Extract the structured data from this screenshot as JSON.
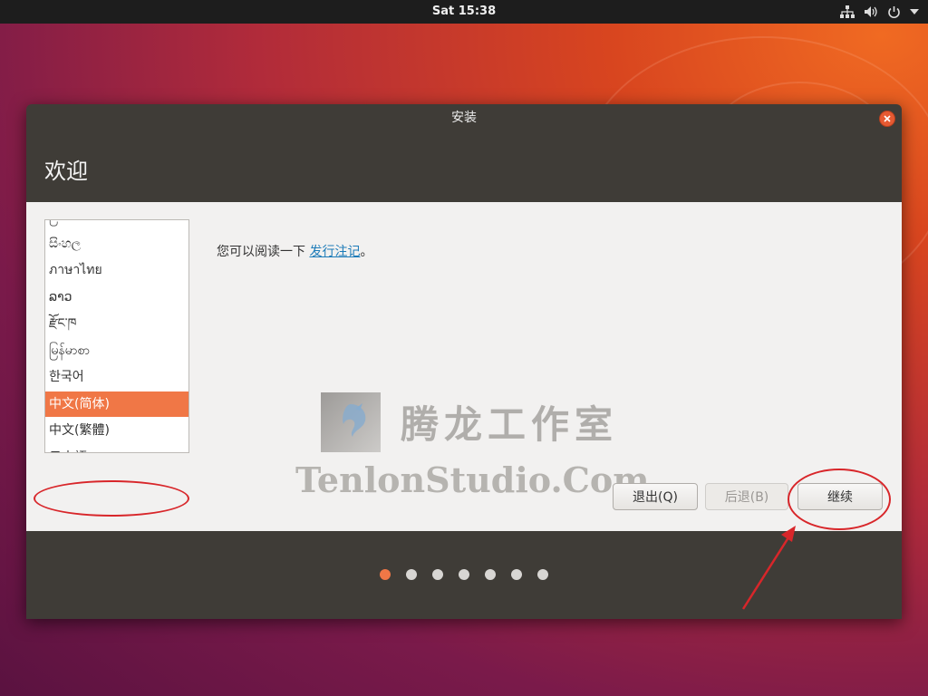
{
  "topbar": {
    "clock": "Sat 15:38"
  },
  "window": {
    "title": "安装",
    "header": "欢迎"
  },
  "languages": [
    {
      "label": "ြ",
      "selected": false
    },
    {
      "label": "සිංහල",
      "selected": false
    },
    {
      "label": "ภาษาไทย",
      "selected": false
    },
    {
      "label": "ລາວ",
      "selected": false
    },
    {
      "label": "རྫོང་ཁ",
      "selected": false
    },
    {
      "label": "မြန်မာစာ",
      "selected": false
    },
    {
      "label": "한국어",
      "selected": false
    },
    {
      "label": "中文(简体)",
      "selected": true
    },
    {
      "label": "中文(繁體)",
      "selected": false
    },
    {
      "label": "日本語",
      "selected": false
    }
  ],
  "note": {
    "prefix": "您可以阅读一下 ",
    "link": "发行注记",
    "suffix": "。"
  },
  "watermark": {
    "cn": "腾龙工作室",
    "en": "TenlonStudio.Com"
  },
  "buttons": {
    "quit": "退出(Q)",
    "back": "后退(B)",
    "next": "继续"
  },
  "progress": {
    "total": 7,
    "current": 1
  },
  "colors": {
    "accent": "#f07746",
    "annotation": "#d8262a",
    "header_bg": "#3f3c37"
  }
}
